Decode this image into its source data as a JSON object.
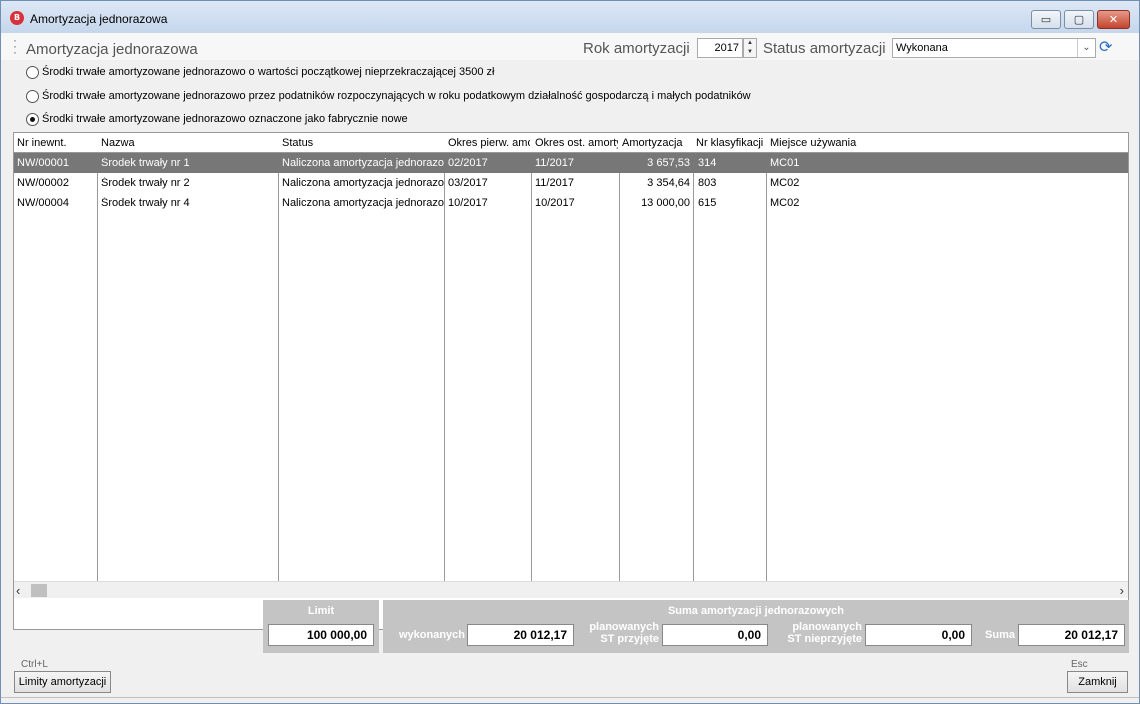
{
  "window": {
    "app_icon": "B",
    "title": "Amortyzacja jednorazowa",
    "controls": {
      "minimize": "▭",
      "maximize": "▢",
      "close": "✕"
    }
  },
  "header": {
    "title": "Amortyzacja jednorazowa",
    "year_label": "Rok amortyzacji",
    "year_value": "2017",
    "status_label": "Status amortyzacji",
    "status_value": "Wykonana"
  },
  "options": [
    {
      "label": "Środki trwałe amortyzowane jednorazowo o wartości początkowej nieprzekraczającej 3500 zł",
      "checked": false
    },
    {
      "label": "Środki trwałe amortyzowane jednorazowo przez podatników rozpoczynających w roku podatkowym działalność gospodarczą i małych podatników",
      "checked": false
    },
    {
      "label": "Środki trwałe amortyzowane jednorazowo oznaczone jako fabrycznie nowe",
      "checked": true
    }
  ],
  "table": {
    "columns": [
      "Nr inewnt.",
      "Nazwa",
      "Status",
      "Okres pierw. amo",
      "Okres ost. amorty",
      "Amortyzacja",
      "Nr klasyfikacji",
      "Miejsce używania"
    ],
    "rows": [
      [
        "NW/00001",
        "Środek trwały nr 1",
        "Naliczona amortyzacja jednorazow",
        "02/2017",
        "11/2017",
        "3 657,53",
        "314",
        "MC01"
      ],
      [
        "NW/00002",
        "Środek trwały nr 2",
        "Naliczona amortyzacja jednorazow",
        "03/2017",
        "11/2017",
        "3 354,64",
        "803",
        "MC02"
      ],
      [
        "NW/00004",
        "Środek trwały nr 4",
        "Naliczona amortyzacja jednorazow",
        "10/2017",
        "10/2017",
        "13 000,00",
        "615",
        "MC02"
      ]
    ],
    "selected_row": 0
  },
  "limit_panel": {
    "title": "Limit",
    "value": "100 000,00"
  },
  "sum_panel": {
    "title": "Suma amortyzacji jednorazowych",
    "wykonanych_label": "wykonanych",
    "wykonanych_value": "20 012,17",
    "przyjete_label_1": "planowanych",
    "przyjete_label_2": "ST przyjęte",
    "przyjete_value": "0,00",
    "nieprzyjete_label_1": "planowanych",
    "nieprzyjete_label_2": "ST nieprzyjęte",
    "nieprzyjete_value": "0,00",
    "suma_label": "Suma",
    "suma_value": "20 012,17"
  },
  "footer": {
    "limits_hotkey": "Ctrl+L",
    "limits_button": "Limity amortyzacji",
    "close_hotkey": "Esc",
    "close_button": "Zamknij"
  }
}
